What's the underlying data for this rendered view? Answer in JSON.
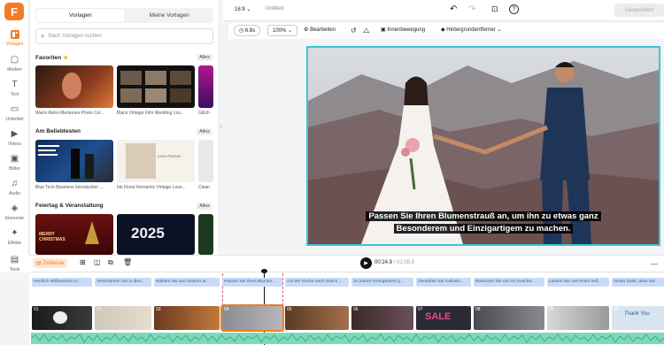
{
  "rail": {
    "logo": "F",
    "items": [
      {
        "label": "Vorlagen",
        "icon": "templates-icon"
      },
      {
        "label": "Medien",
        "icon": "media-icon"
      },
      {
        "label": "Text",
        "icon": "text-icon"
      },
      {
        "label": "Untertitel",
        "icon": "subtitle-icon"
      },
      {
        "label": "Videos",
        "icon": "videos-icon"
      },
      {
        "label": "Bilder",
        "icon": "images-icon"
      },
      {
        "label": "Audio",
        "icon": "audio-icon"
      },
      {
        "label": "Elemente",
        "icon": "elements-icon"
      },
      {
        "label": "Effekte",
        "icon": "effects-icon"
      },
      {
        "label": "Tools",
        "icon": "tools-icon"
      }
    ]
  },
  "panel": {
    "tabs": [
      "Vorlagen",
      "Meine Vorlagen"
    ],
    "search_placeholder": "Nach Vorlagen suchen",
    "sections": [
      {
        "title": "Favoriten",
        "all": "Alles",
        "captions": [
          "Warm Retro Memories Photo Col...",
          "Black Vintage Film Wedding Lov...",
          "Glitch"
        ]
      },
      {
        "title": "Am Beliebtesten",
        "all": "Alles",
        "captions": [
          "Blue Tech Business Introduction ...",
          "Ink Floral Romantic Vintage Love...",
          "Clean"
        ]
      },
      {
        "title": "Feiertag & Veranstaltung",
        "all": "Alles",
        "captions": [
          "",
          "",
          ""
        ]
      }
    ],
    "thumb_text": {
      "christmas": "MERRY CHRISTMAS",
      "year": "2025",
      "forever": "Love Forever"
    }
  },
  "topbar": {
    "ratio": "16:9",
    "title": "Untitled",
    "saved": "Gespeichert"
  },
  "editbar": {
    "duration": "6.8s",
    "zoom": "100%",
    "edit": "Bearbeiten",
    "motion": "Innenbewegung",
    "bg_remover": "Hintergrundentferner"
  },
  "preview": {
    "subtitle_line1": "Passen Sie Ihren Blumenstrauß an, um ihn zu etwas ganz",
    "subtitle_line2": "Besonderem und Einzigartigem zu machen."
  },
  "timeline": {
    "timeline_label": "Zeitleiste",
    "current_time": "00:24.9",
    "total_time": "01:08.5",
    "captions": [
      "Herzlich Willkommen in ...",
      "Verschönern Sie in dies...",
      "Wählen Sie aus unserer at...",
      "Passen Sie Ihren Blumen...",
      "Auf der Suche nach Gesch...",
      "Zu jedem Arrangement g...",
      "Genießen Sie exklusiv...",
      "Besuchen Sie uns im Geschä...",
      "Lassen Sie uns Ihnen helf...",
      "Vielen Dank, dass Sie"
    ],
    "clips": [
      "01",
      "02",
      "03",
      "04",
      "05",
      "06",
      "07",
      "08",
      "09",
      "10"
    ],
    "clip_texts": {
      "sale": "SALE",
      "thank": "Thank You"
    }
  },
  "colors": {
    "accent": "#f57b20",
    "selection": "#3cc6d6",
    "caption_bg": "#c9dbf8",
    "waveform": "#7fd9b8"
  }
}
